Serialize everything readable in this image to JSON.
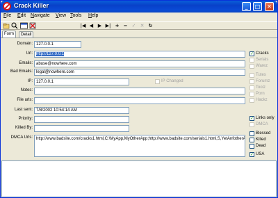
{
  "window": {
    "title": "Crack Killer"
  },
  "titlebar_buttons": {
    "minimize": "_",
    "maximize": "□",
    "close": "✕"
  },
  "menu": [
    {
      "label": "File",
      "key": "F"
    },
    {
      "label": "Edit",
      "key": "E"
    },
    {
      "label": "Navigate",
      "key": "N"
    },
    {
      "label": "View",
      "key": "V"
    },
    {
      "label": "Tools",
      "key": "T"
    },
    {
      "label": "Help",
      "key": "H"
    }
  ],
  "toolbar": {
    "nav_first": "|◀",
    "nav_prev": "◀",
    "nav_next": "▶",
    "nav_last": "▶|",
    "add": "+",
    "remove": "−",
    "accept": "✓",
    "cancel": "✕",
    "refresh": "↻"
  },
  "tabs": [
    {
      "label": "Form"
    },
    {
      "label": "Detail"
    }
  ],
  "form": {
    "domain": {
      "label": "Domain:",
      "value": "127.0.0.1"
    },
    "url": {
      "label": "Url:",
      "value": "http://127.0.0.1"
    },
    "emails": {
      "label": "Emails:",
      "value": "abuse@nowhere.com"
    },
    "bad_emails": {
      "label": "Bad Emails:",
      "value": "legal@nowhere.com"
    },
    "ip": {
      "label": "IP:",
      "value": "127.0.0.1"
    },
    "ip_changed": {
      "label": "IP Changed",
      "checked": false
    },
    "notes": {
      "label": "Notes:",
      "value": ""
    },
    "file_urls": {
      "label": "File urls:",
      "value": ""
    },
    "last_sent": {
      "label": "Last sent:",
      "value": "7/8/2002 10:54:14 AM"
    },
    "priority": {
      "label": "Priority:",
      "value": ""
    },
    "killed_by": {
      "label": "Killed By:",
      "value": ""
    },
    "dmca_urls": {
      "label": "DMCA Urls:",
      "value": "http://www.badsite.com/cracks1.html,C:\\MyApp,MyOtherApp;http://www.badsite.com/serials1.html,S,YetAnfotherApp;http://www.badsite.com/warez1.html,W,MyApp"
    }
  },
  "checks_group1": [
    {
      "label": "Cracks",
      "checked": true,
      "enabled": true
    },
    {
      "label": "Serials",
      "checked": false,
      "enabled": false
    },
    {
      "label": "Warez",
      "checked": false,
      "enabled": false
    }
  ],
  "checks_group2": [
    {
      "label": "Tutes",
      "checked": false,
      "enabled": false
    },
    {
      "label": "Forumz",
      "checked": false,
      "enabled": false
    },
    {
      "label": "Toolz",
      "checked": false,
      "enabled": false
    },
    {
      "label": "Porn",
      "checked": false,
      "enabled": false
    },
    {
      "label": "Hackz",
      "checked": false,
      "enabled": false
    }
  ],
  "checks_group3": [
    {
      "label": "Links only",
      "checked": true,
      "enabled": true
    },
    {
      "label": "DMCA",
      "checked": false,
      "enabled": false
    }
  ],
  "checks_group4": [
    {
      "label": "Blessed",
      "checked": false,
      "enabled": true
    },
    {
      "label": "Killed",
      "checked": false,
      "enabled": true
    },
    {
      "label": "Dead",
      "checked": false,
      "enabled": true
    },
    {
      "label": "USA",
      "checked": true,
      "enabled": true
    }
  ]
}
